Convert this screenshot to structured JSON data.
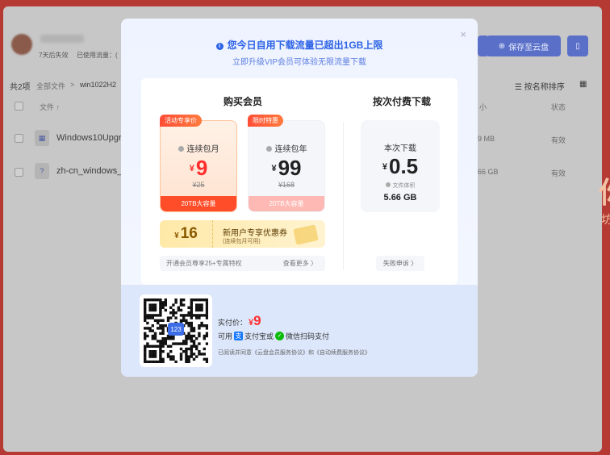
{
  "background": {
    "status_line": "7天后失效",
    "used_traffic": "已使用流量：(",
    "save_button": "保存至云盘",
    "total_count": "共2项",
    "breadcrumb_root": "全部文件",
    "breadcrumb_current": "win1022H2",
    "sort_label": "按名称排序",
    "col_file": "文件 ↑",
    "col_size": "小",
    "col_status": "状态",
    "rows": [
      {
        "icon": "windows-icon",
        "name": "Windows10Upgr",
        "size": "9 MB",
        "status": "有效"
      },
      {
        "icon": "question-icon",
        "name": "zh-cn_windows_1",
        "size": "66 GB",
        "status": "有效"
      }
    ],
    "right_big": "你",
    "right_small": "坊"
  },
  "modal": {
    "close_glyph": "×",
    "warning": "您今日自用下载流量已超出1GB上限",
    "subtitle": "立即升级VIP会员可体验无限流量下载",
    "membership_title": "购买会员",
    "per_download_title": "按次付费下载",
    "plans": [
      {
        "tag": "活动专享价",
        "name": "连续包月",
        "currency": "¥",
        "price": "9",
        "original": "¥25",
        "footer": "20TB大容量"
      },
      {
        "tag": "限时特惠",
        "name": "连续包年",
        "currency": "¥",
        "price": "99",
        "original": "¥168",
        "footer": "20TB大容量"
      }
    ],
    "coupon": {
      "currency": "¥",
      "amount": "16",
      "title": "新用户专享优惠券",
      "note": "(连续包月可用)"
    },
    "vip_bar": {
      "text": "开通会员尊享25+专属特权",
      "more": "查看更多 〉"
    },
    "per_download": {
      "label": "本次下载",
      "currency": "¥",
      "price": "0.5",
      "size_label": "文件体积",
      "size": "5.66 GB"
    },
    "fail_button": "失败申诉 〉",
    "pay": {
      "price_label": "实付价：",
      "currency": "¥",
      "price": "9",
      "methods_prefix": "可用",
      "alipay": "支付宝或",
      "wechat": "微信扫码支付",
      "agreement": "已阅读并同意《云盘会员服务协议》和《自动续费服务协议》",
      "qr_center": "123"
    }
  },
  "colors": {
    "accent": "#2d63e7",
    "price_red": "#ff2d2d",
    "coupon_gold": "#ffe9a8"
  }
}
